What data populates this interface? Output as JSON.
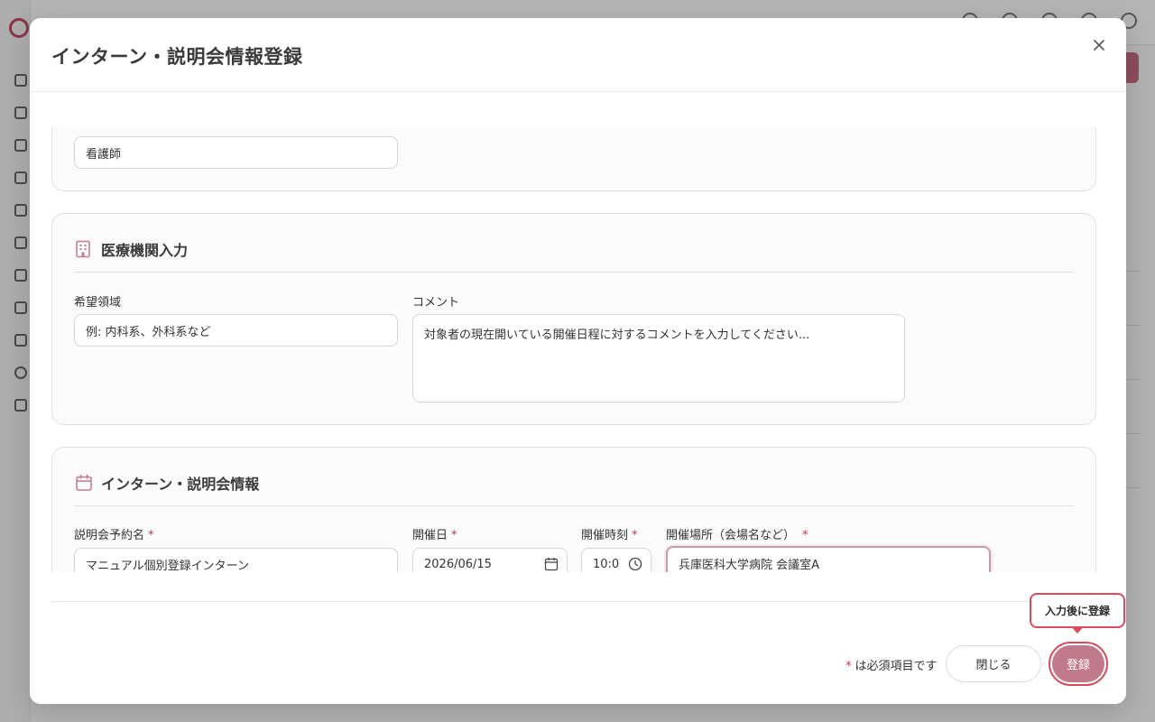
{
  "modal": {
    "title": "インターン・説明会情報登録",
    "close_icon": "close-icon"
  },
  "top_section": {
    "field_value": "看護師"
  },
  "medical_section": {
    "title": "医療機関入力",
    "icon": "building-icon",
    "desired_field": {
      "label": "希望領域",
      "placeholder": "例: 内科系、外科系など"
    },
    "comment": {
      "label": "コメント",
      "placeholder": "対象者の現在開いている開催日程に対するコメントを入力してください..."
    }
  },
  "event_section": {
    "title": "インターン・説明会情報",
    "icon": "calendar-icon",
    "event_name": {
      "label": "説明会予約名",
      "required": "*",
      "value": "マニュアル個別登録インターン"
    },
    "event_date": {
      "label": "開催日",
      "required": "*",
      "value": "2026/06/15",
      "icon": "calendar-icon"
    },
    "event_time": {
      "label": "開催時刻",
      "required": "*",
      "value": "10:0",
      "icon": "clock-icon"
    },
    "venue": {
      "label": "開催場所（会場名など）",
      "required": "*",
      "value": "兵庫医科大学病院 会議室A"
    }
  },
  "footer": {
    "required_mark": "*",
    "required_note": "は必須項目です",
    "close_label": "閉じる",
    "submit_label": "登録",
    "tooltip": "入力後に登録"
  },
  "colors": {
    "accent": "#c07a8b",
    "required": "#c4334e",
    "highlight": "#d94a5d"
  }
}
